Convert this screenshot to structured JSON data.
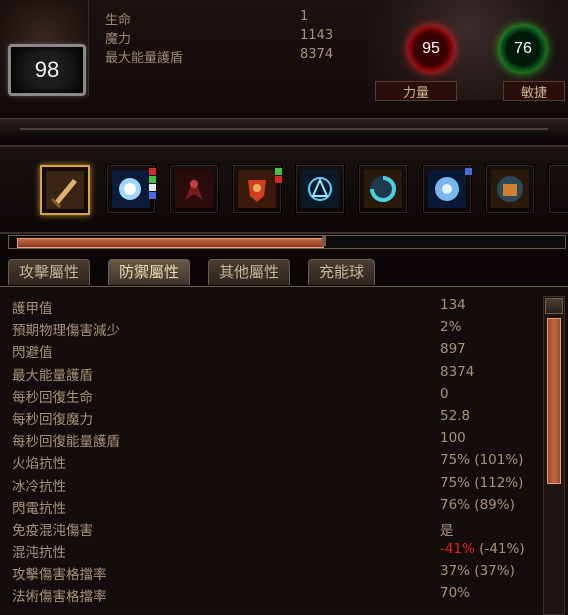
{
  "character": {
    "level": "98",
    "stats": [
      {
        "label": "生命",
        "value": "1"
      },
      {
        "label": "魔力",
        "value": "1143"
      },
      {
        "label": "最大能量護盾",
        "value": "8374"
      }
    ],
    "strength": {
      "value": "95",
      "label": "力量"
    },
    "dexterity": {
      "value": "76",
      "label": "敏捷"
    }
  },
  "skills": [
    {
      "name": "sword-gem-icon",
      "selected": true
    },
    {
      "name": "lightning-orb-icon",
      "sockets": [
        "r",
        "g",
        "w",
        "b"
      ]
    },
    {
      "name": "dark-winged-icon"
    },
    {
      "name": "shield-warrior-icon",
      "sockets": [
        "g",
        "r"
      ]
    },
    {
      "name": "arcane-rune-icon"
    },
    {
      "name": "cyan-spiral-icon"
    },
    {
      "name": "frost-nova-icon",
      "sockets": [
        "b"
      ]
    },
    {
      "name": "fist-vortex-icon"
    }
  ],
  "experience": {
    "progress": 0.55
  },
  "tabs": [
    "攻擊屬性",
    "防禦屬性",
    "其他屬性",
    "充能球"
  ],
  "defenses": [
    {
      "label": "護甲值",
      "value": "134"
    },
    {
      "label": "預期物理傷害減少",
      "value": "2%"
    },
    {
      "label": "閃避值",
      "value": "897"
    },
    {
      "label": "最大能量護盾",
      "value": "8374"
    },
    {
      "label": "每秒回復生命",
      "value": "0"
    },
    {
      "label": "每秒回復魔力",
      "value": "52.8"
    },
    {
      "label": "每秒回復能量護盾",
      "value": "100"
    },
    {
      "label": "火焰抗性",
      "value": "75% (101%)"
    },
    {
      "label": "冰冷抗性",
      "value": "75% (112%)"
    },
    {
      "label": "閃電抗性",
      "value": "76% (89%)"
    },
    {
      "label": "免疫混沌傷害",
      "value": "是"
    },
    {
      "label": "混沌抗性",
      "value_neg": "-41%",
      "value_rest": " (-41%)"
    },
    {
      "label": "攻擊傷害格擋率",
      "value": "37% (37%)"
    },
    {
      "label": "法術傷害格擋率",
      "value": "70%"
    }
  ]
}
